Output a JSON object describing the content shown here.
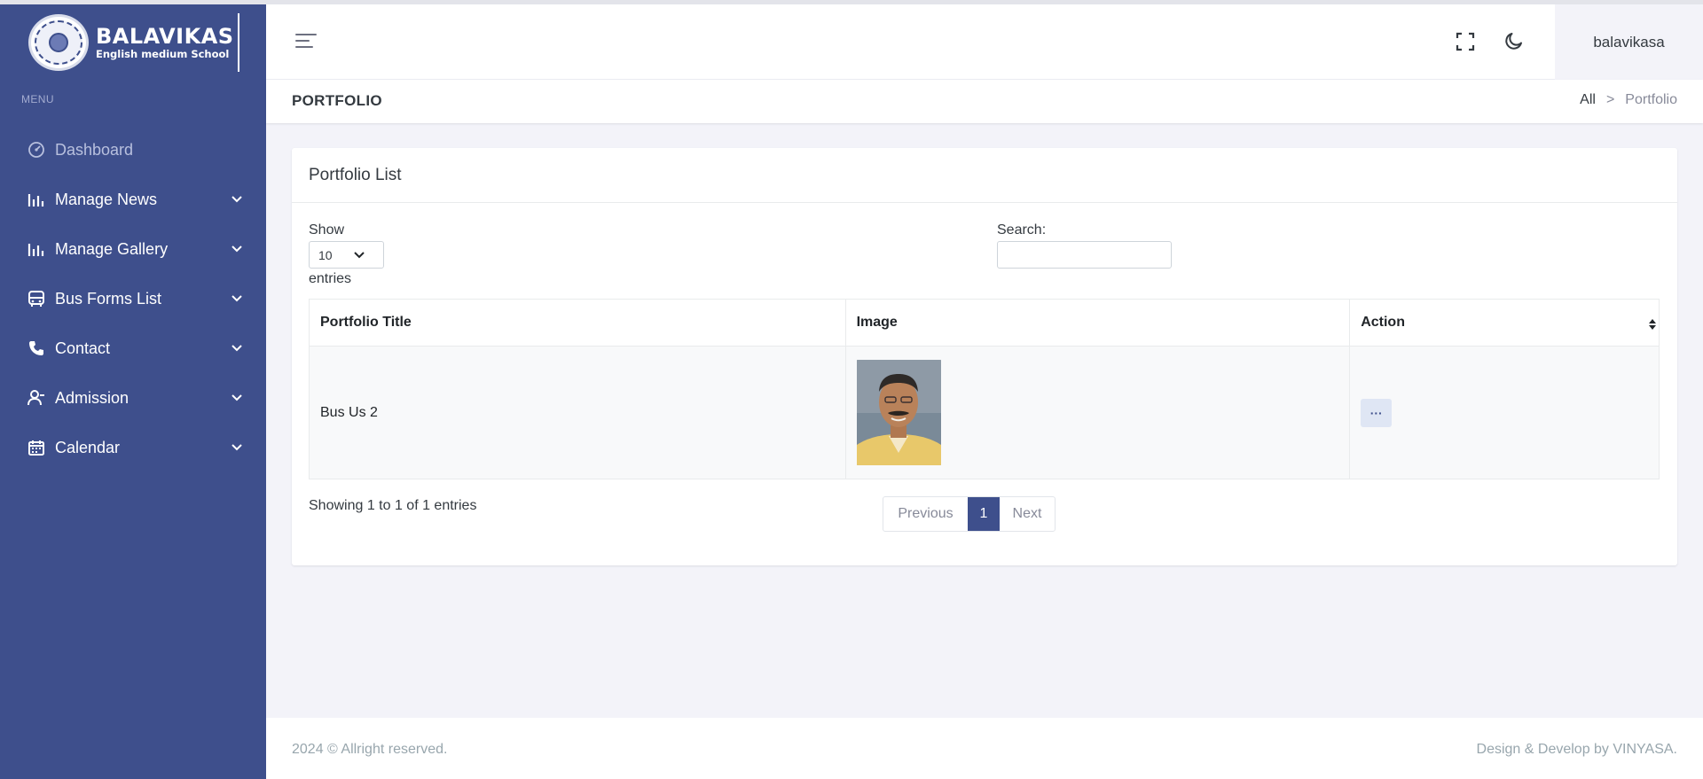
{
  "brand": {
    "title": "BALAVIKAS",
    "subtitle": "English medium School",
    "sidebar_color": "#3e4f8c"
  },
  "sidebar": {
    "menu_title": "MENU",
    "items": [
      {
        "label": "Dashboard",
        "icon": "speedometer-icon",
        "has_submenu": false
      },
      {
        "label": "Manage News",
        "icon": "bar-chart-icon",
        "has_submenu": true
      },
      {
        "label": "Manage Gallery",
        "icon": "bar-chart-icon",
        "has_submenu": true
      },
      {
        "label": "Bus Forms List",
        "icon": "bus-icon",
        "has_submenu": true
      },
      {
        "label": "Contact",
        "icon": "phone-icon",
        "has_submenu": true
      },
      {
        "label": "Admission",
        "icon": "user-icon",
        "has_submenu": true
      },
      {
        "label": "Calendar",
        "icon": "calendar-icon",
        "has_submenu": true
      }
    ]
  },
  "header": {
    "username": "balavikasa",
    "icons": [
      "hamburger-menu-icon",
      "fullscreen-icon",
      "moon-icon"
    ]
  },
  "page": {
    "title": "PORTFOLIO",
    "breadcrumb": {
      "root": "All",
      "separator": ">",
      "current": "Portfolio"
    }
  },
  "card": {
    "title": "Portfolio List",
    "show_label": "Show",
    "entries_value": "10",
    "entries_label": "entries",
    "search_label": "Search:",
    "search_value": "",
    "columns": [
      "Portfolio Title",
      "Image",
      "Action"
    ],
    "rows": [
      {
        "title": "Bus Us 2",
        "image": "portrait-photo",
        "action": "···"
      }
    ],
    "info": "Showing 1 to 1 of 1 entries",
    "pagination": {
      "previous": "Previous",
      "current": "1",
      "next": "Next"
    }
  },
  "footer": {
    "left": "2024 © Allright reserved.",
    "right": "Design & Develop by VINYASA."
  }
}
